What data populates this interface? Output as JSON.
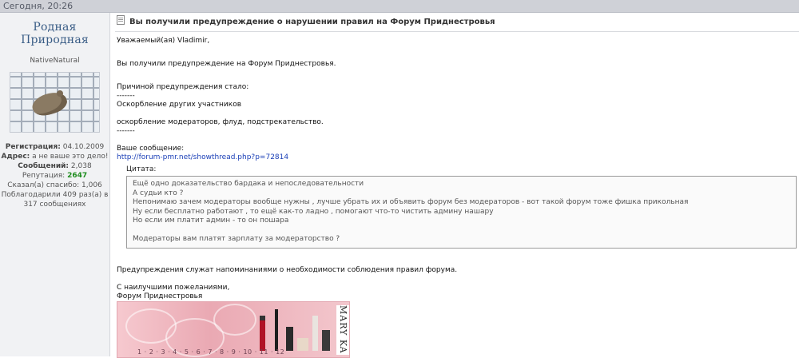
{
  "header": {
    "timestamp": "Сегодня, 20:26"
  },
  "user": {
    "name": "Родная Природная",
    "title": "NativeNatural",
    "registration_label": "Регистрация:",
    "registration_value": "04.10.2009",
    "address_label": "Адрес:",
    "address_value": "а не ваше это дело!",
    "posts_label": "Сообщений:",
    "posts_value": "2,038",
    "reputation_label": "Репутация:",
    "reputation_value": "2647",
    "thanks_said": "Сказал(а) спасибо: 1,006",
    "thanked_line1": "Поблагодарили 409 раз(а) в",
    "thanked_line2": "317 сообщениях"
  },
  "message": {
    "subject": "Вы получили предупреждение о нарушении правил на Форум Приднестровья",
    "greeting": "Уважаемый(ая) Vladimir,",
    "intro": "Вы получили предупреждение на Форум Приднестровья.",
    "reason_label": "Причиной предупреждения стало:",
    "separator": "-------",
    "reason_1": "Оскорбление других участников",
    "reason_2": "оскорбление модераторов, флуд, подстрекательство.",
    "your_message_label": "Ваше сообщение:",
    "message_link": "http://forum-pmr.net/showthread.php?p=72814",
    "quote_label": "Цитата:",
    "quote_lines": [
      "Ещё одно доказательство бардака и непоследовательности",
      "А судьи кто ?",
      "Непонимаю зачем модераторы вообще нужны , лучше убрать их и объявить форум без модераторов - вот такой форум тоже фишка прикольная",
      "Ну если бесплатно работают , то ещё как-то ладно , помогают что-то чистить админу нашару",
      "Но если им платит админ - то он пошара",
      "",
      "Модераторы вам платят зарплату за модераторство ?"
    ],
    "reminder": "Предупреждения служат напоминаниями о необходимости соблюдения правил форума.",
    "closing_1": "С наилучшими пожеланиями,",
    "closing_2": "Форум Приднестровья"
  },
  "signature": {
    "banner_numbers": "1 · 2 · 3 · 4 · 5 · 6 · 7 · 8 · 9 · 10 · 11 · 12",
    "banner_brand": "MARY KA"
  }
}
